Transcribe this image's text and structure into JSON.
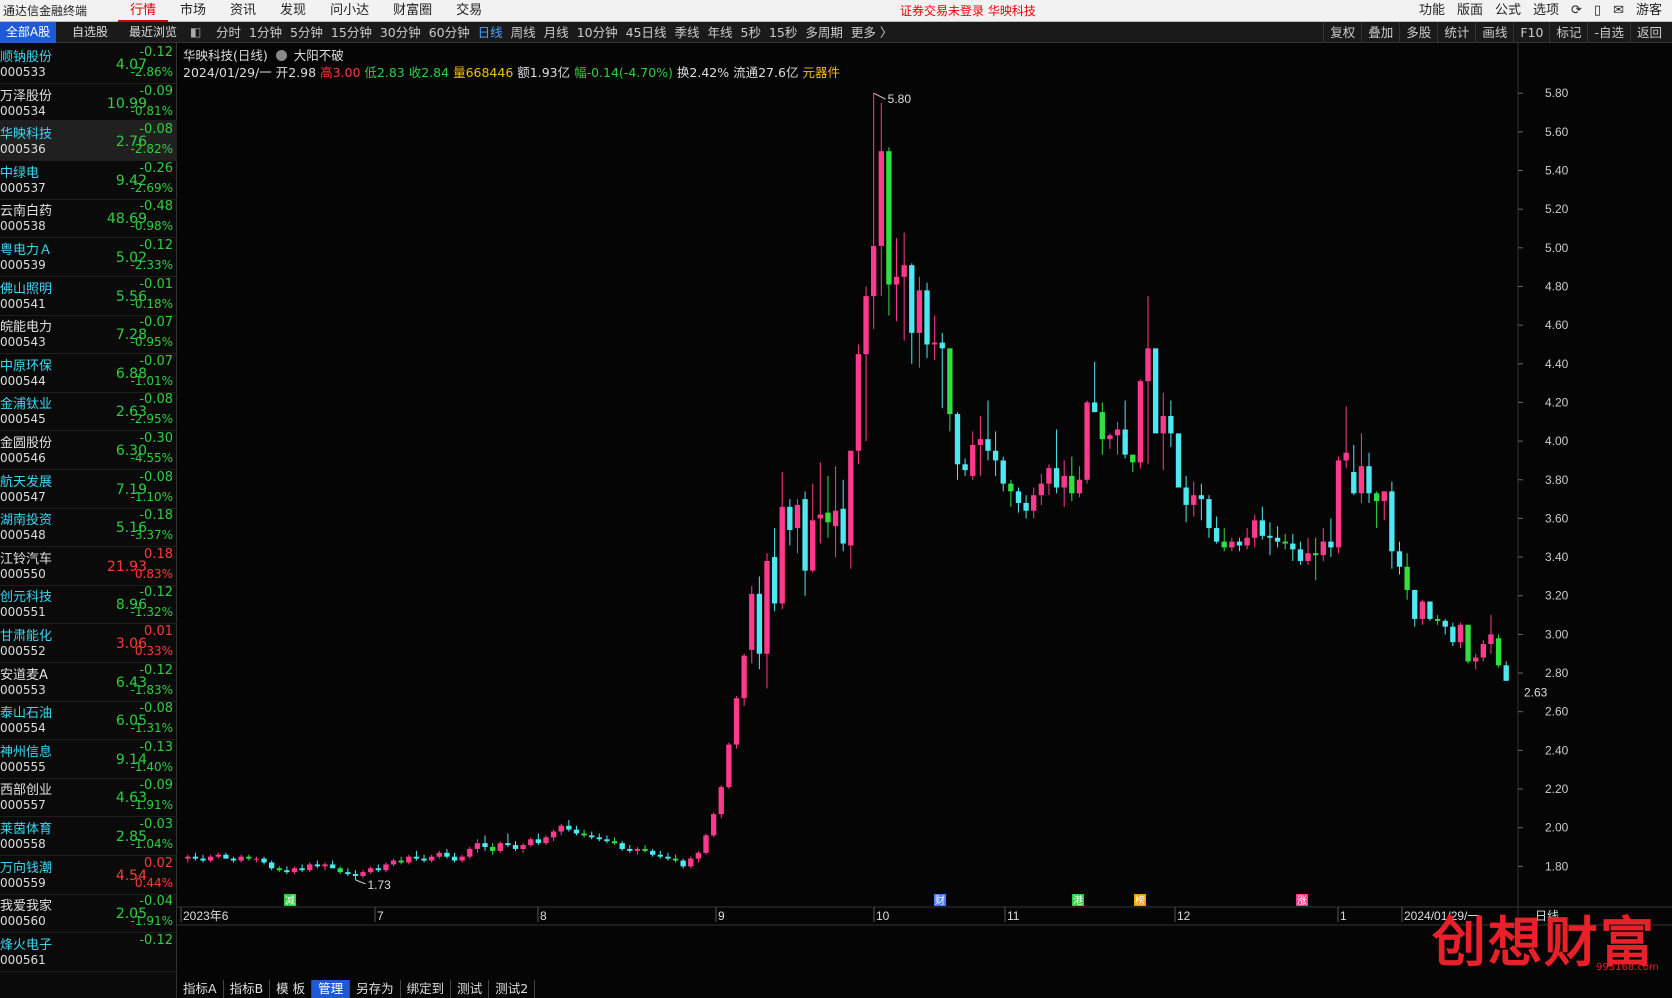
{
  "topbar": {
    "app_title": "通达信金融终端",
    "menu": [
      "行情",
      "市场",
      "资讯",
      "发现",
      "问小达",
      "财富圈",
      "交易"
    ],
    "active_menu": "行情",
    "notice": "证券交易未登录  华映科技",
    "right": [
      "功能",
      "版面",
      "公式",
      "选项",
      "⟳",
      "▯",
      "✉",
      "游客"
    ]
  },
  "periodbar": {
    "list_tabs": [
      "全部A股",
      "自选股",
      "最近浏览"
    ],
    "periods": [
      "分时",
      "1分钟",
      "5分钟",
      "15分钟",
      "30分钟",
      "60分钟",
      "日线",
      "周线",
      "月线",
      "10分钟",
      "45日线",
      "季线",
      "年线",
      "5秒",
      "15秒",
      "多周期",
      "更多 〉"
    ],
    "active_period": "日线",
    "tools": [
      "复权",
      "叠加",
      "多股",
      "统计",
      "画线",
      "F10",
      "标记",
      "-自选",
      "返回"
    ]
  },
  "stocks": [
    {
      "name": "顺钠股份",
      "code": "000533",
      "price": "4.07",
      "chg": "-0.12",
      "pct": "-2.86%"
    },
    {
      "name": "万泽股份",
      "code": "000534",
      "price": "10.99",
      "chg": "-0.09",
      "pct": "-0.81%"
    },
    {
      "name": "华映科技",
      "code": "000536",
      "price": "2.76",
      "chg": "-0.08",
      "pct": "-2.82%"
    },
    {
      "name": "中绿电",
      "code": "000537",
      "price": "9.42",
      "chg": "-0.26",
      "pct": "-2.69%"
    },
    {
      "name": "云南白药",
      "code": "000538",
      "price": "48.69",
      "chg": "-0.48",
      "pct": "-0.98%"
    },
    {
      "name": "粤电力Ａ",
      "code": "000539",
      "price": "5.02",
      "chg": "-0.12",
      "pct": "-2.33%"
    },
    {
      "name": "佛山照明",
      "code": "000541",
      "price": "5.56",
      "chg": "-0.01",
      "pct": "-0.18%"
    },
    {
      "name": "皖能电力",
      "code": "000543",
      "price": "7.28",
      "chg": "-0.07",
      "pct": "-0.95%"
    },
    {
      "name": "中原环保",
      "code": "000544",
      "price": "6.88",
      "chg": "-0.07",
      "pct": "-1.01%"
    },
    {
      "name": "金浦钛业",
      "code": "000545",
      "price": "2.63",
      "chg": "-0.08",
      "pct": "-2.95%"
    },
    {
      "name": "金圆股份",
      "code": "000546",
      "price": "6.30",
      "chg": "-0.30",
      "pct": "-4.55%"
    },
    {
      "name": "航天发展",
      "code": "000547",
      "price": "7.19",
      "chg": "-0.08",
      "pct": "-1.10%"
    },
    {
      "name": "湖南投资",
      "code": "000548",
      "price": "5.16",
      "chg": "-0.18",
      "pct": "-3.37%"
    },
    {
      "name": "江铃汽车",
      "code": "000550",
      "price": "21.93",
      "chg": "0.18",
      "pct": "0.83%"
    },
    {
      "name": "创元科技",
      "code": "000551",
      "price": "8.96",
      "chg": "-0.12",
      "pct": "-1.32%"
    },
    {
      "name": "甘肃能化",
      "code": "000552",
      "price": "3.06",
      "chg": "0.01",
      "pct": "0.33%"
    },
    {
      "name": "安道麦A",
      "code": "000553",
      "price": "6.43",
      "chg": "-0.12",
      "pct": "-1.83%"
    },
    {
      "name": "泰山石油",
      "code": "000554",
      "price": "6.05",
      "chg": "-0.08",
      "pct": "-1.31%"
    },
    {
      "name": "神州信息",
      "code": "000555",
      "price": "9.14",
      "chg": "-0.13",
      "pct": "-1.40%"
    },
    {
      "name": "西部创业",
      "code": "000557",
      "price": "4.63",
      "chg": "-0.09",
      "pct": "-1.91%"
    },
    {
      "name": "莱茵体育",
      "code": "000558",
      "price": "2.85",
      "chg": "-0.03",
      "pct": "-1.04%"
    },
    {
      "name": "万向钱潮",
      "code": "000559",
      "price": "4.54",
      "chg": "0.02",
      "pct": "0.44%"
    },
    {
      "name": "我爱我家",
      "code": "000560",
      "price": "2.05",
      "chg": "-0.04",
      "pct": "-1.91%"
    },
    {
      "name": "烽火电子",
      "code": "000561",
      "price": "",
      "chg": "-0.12",
      "pct": ""
    }
  ],
  "chart_header": {
    "title": "华映科技(日线)",
    "signal": "大阳不破",
    "date": "2024/01/29/一",
    "open": "开2.98",
    "high": "高3.00",
    "low": "低2.83",
    "close": "收2.84",
    "vol": "量668446",
    "amt": "额1.93亿",
    "range": "幅-0.14(-4.70%)",
    "turnover": "换2.42%",
    "float": "流通27.6亿",
    "sector": "元器件"
  },
  "bottomtabs": [
    "指标A",
    "指标B",
    "模 板",
    "管理",
    "另存为",
    "绑定到",
    "测试",
    "测试2"
  ],
  "watermark": {
    "text": "创想财富",
    "url": "995168.com"
  },
  "colors": {
    "up": "#ff3a8c",
    "down_cyan": "#4ee8f0",
    "down_green": "#30e040"
  },
  "chart_data": {
    "type": "candlestick",
    "title": "华映科技(日线)",
    "ylim": [
      1.6,
      5.92
    ],
    "yticks": [
      "5.80",
      "5.60",
      "5.40",
      "5.20",
      "5.00",
      "4.80",
      "4.60",
      "4.40",
      "4.20",
      "4.00",
      "3.80",
      "3.60",
      "3.40",
      "3.20",
      "3.00",
      "2.80",
      "2.60",
      "2.40",
      "2.20",
      "2.00",
      "1.80"
    ],
    "xlabels": [
      "2023年6",
      "7",
      "8",
      "9",
      "10",
      "11",
      "12",
      "1",
      "2024/01/29/一"
    ],
    "annotations": {
      "high": "5.80",
      "low": "1.73",
      "last_price": "2.63",
      "period_label": "日线"
    },
    "event_markers": [
      "减",
      "财",
      "港",
      "榜",
      "涨"
    ],
    "candles": [
      [
        1.84,
        1.86,
        1.82,
        1.85
      ],
      [
        1.85,
        1.87,
        1.83,
        1.84
      ],
      [
        1.84,
        1.86,
        1.82,
        1.83
      ],
      [
        1.83,
        1.86,
        1.82,
        1.85
      ],
      [
        1.85,
        1.87,
        1.84,
        1.86
      ],
      [
        1.86,
        1.87,
        1.84,
        1.84
      ],
      [
        1.84,
        1.85,
        1.82,
        1.83
      ],
      [
        1.83,
        1.86,
        1.82,
        1.85
      ],
      [
        1.85,
        1.86,
        1.83,
        1.84
      ],
      [
        1.84,
        1.85,
        1.82,
        1.84
      ],
      [
        1.84,
        1.85,
        1.81,
        1.82
      ],
      [
        1.82,
        1.83,
        1.78,
        1.79
      ],
      [
        1.79,
        1.8,
        1.77,
        1.78
      ],
      [
        1.78,
        1.8,
        1.76,
        1.77
      ],
      [
        1.77,
        1.8,
        1.76,
        1.79
      ],
      [
        1.79,
        1.81,
        1.77,
        1.78
      ],
      [
        1.78,
        1.82,
        1.77,
        1.81
      ],
      [
        1.81,
        1.83,
        1.79,
        1.8
      ],
      [
        1.8,
        1.82,
        1.78,
        1.81
      ],
      [
        1.81,
        1.83,
        1.79,
        1.79
      ],
      [
        1.79,
        1.8,
        1.76,
        1.77
      ],
      [
        1.77,
        1.79,
        1.75,
        1.76
      ],
      [
        1.76,
        1.78,
        1.73,
        1.75
      ],
      [
        1.75,
        1.78,
        1.74,
        1.77
      ],
      [
        1.77,
        1.8,
        1.76,
        1.79
      ],
      [
        1.79,
        1.81,
        1.77,
        1.78
      ],
      [
        1.78,
        1.82,
        1.77,
        1.81
      ],
      [
        1.81,
        1.84,
        1.8,
        1.83
      ],
      [
        1.83,
        1.85,
        1.81,
        1.82
      ],
      [
        1.82,
        1.86,
        1.81,
        1.85
      ],
      [
        1.85,
        1.88,
        1.83,
        1.84
      ],
      [
        1.84,
        1.86,
        1.82,
        1.83
      ],
      [
        1.83,
        1.86,
        1.82,
        1.85
      ],
      [
        1.85,
        1.88,
        1.84,
        1.87
      ],
      [
        1.87,
        1.89,
        1.84,
        1.85
      ],
      [
        1.85,
        1.87,
        1.82,
        1.83
      ],
      [
        1.83,
        1.86,
        1.82,
        1.85
      ],
      [
        1.85,
        1.9,
        1.84,
        1.89
      ],
      [
        1.89,
        1.94,
        1.87,
        1.92
      ],
      [
        1.92,
        1.96,
        1.88,
        1.9
      ],
      [
        1.9,
        1.92,
        1.86,
        1.88
      ],
      [
        1.88,
        1.93,
        1.87,
        1.92
      ],
      [
        1.92,
        1.97,
        1.9,
        1.91
      ],
      [
        1.91,
        1.93,
        1.88,
        1.89
      ],
      [
        1.89,
        1.92,
        1.87,
        1.91
      ],
      [
        1.91,
        1.95,
        1.9,
        1.94
      ],
      [
        1.94,
        1.97,
        1.91,
        1.92
      ],
      [
        1.92,
        1.96,
        1.91,
        1.95
      ],
      [
        1.95,
        1.99,
        1.93,
        1.98
      ],
      [
        1.98,
        2.02,
        1.96,
        2.01
      ],
      [
        2.01,
        2.04,
        1.98,
        1.99
      ],
      [
        1.99,
        2.01,
        1.96,
        1.97
      ],
      [
        1.97,
        1.99,
        1.95,
        1.96
      ],
      [
        1.96,
        1.98,
        1.94,
        1.95
      ],
      [
        1.95,
        1.97,
        1.93,
        1.94
      ],
      [
        1.94,
        1.96,
        1.92,
        1.93
      ],
      [
        1.93,
        1.95,
        1.91,
        1.92
      ],
      [
        1.92,
        1.93,
        1.88,
        1.89
      ],
      [
        1.89,
        1.91,
        1.87,
        1.88
      ],
      [
        1.88,
        1.9,
        1.86,
        1.89
      ],
      [
        1.89,
        1.91,
        1.87,
        1.88
      ],
      [
        1.88,
        1.89,
        1.85,
        1.86
      ],
      [
        1.86,
        1.88,
        1.84,
        1.85
      ],
      [
        1.85,
        1.87,
        1.83,
        1.84
      ],
      [
        1.84,
        1.86,
        1.82,
        1.83
      ],
      [
        1.83,
        1.84,
        1.79,
        1.8
      ],
      [
        1.8,
        1.85,
        1.79,
        1.84
      ],
      [
        1.84,
        1.88,
        1.82,
        1.87
      ],
      [
        1.87,
        1.97,
        1.86,
        1.96
      ],
      [
        1.96,
        2.08,
        1.95,
        2.07
      ],
      [
        2.07,
        2.22,
        2.05,
        2.21
      ],
      [
        2.21,
        2.44,
        2.2,
        2.43
      ],
      [
        2.43,
        2.68,
        2.41,
        2.67
      ],
      [
        2.67,
        2.9,
        2.63,
        2.89
      ],
      [
        2.92,
        3.25,
        2.85,
        3.21
      ],
      [
        3.21,
        3.3,
        2.82,
        2.9
      ],
      [
        2.9,
        3.42,
        2.72,
        3.38
      ],
      [
        3.4,
        3.55,
        3.12,
        3.16
      ],
      [
        3.16,
        3.84,
        3.13,
        3.66
      ],
      [
        3.66,
        3.7,
        3.46,
        3.54
      ],
      [
        3.55,
        3.7,
        3.42,
        3.67
      ],
      [
        3.7,
        3.74,
        3.2,
        3.33
      ],
      [
        3.33,
        3.78,
        3.32,
        3.59
      ],
      [
        3.6,
        3.89,
        3.47,
        3.62
      ],
      [
        3.63,
        3.82,
        3.5,
        3.58
      ],
      [
        3.56,
        3.87,
        3.4,
        3.64
      ],
      [
        3.65,
        3.8,
        3.43,
        3.47
      ],
      [
        3.46,
        3.95,
        3.34,
        3.95
      ],
      [
        3.95,
        4.5,
        3.88,
        4.45
      ],
      [
        4.45,
        4.8,
        4.0,
        4.75
      ],
      [
        4.75,
        5.8,
        4.58,
        5.01
      ],
      [
        5.01,
        5.75,
        4.75,
        5.5
      ],
      [
        5.5,
        5.52,
        4.65,
        4.81
      ],
      [
        4.81,
        5.05,
        4.62,
        4.85
      ],
      [
        4.85,
        5.08,
        4.52,
        4.91
      ],
      [
        4.91,
        4.92,
        4.4,
        4.56
      ],
      [
        4.56,
        4.85,
        4.38,
        4.78
      ],
      [
        4.78,
        4.82,
        4.43,
        4.5
      ],
      [
        4.5,
        4.65,
        4.42,
        4.51
      ],
      [
        4.51,
        4.56,
        4.17,
        4.48
      ],
      [
        4.48,
        4.44,
        4.05,
        4.14
      ],
      [
        4.14,
        4.15,
        3.8,
        3.88
      ],
      [
        3.88,
        3.91,
        3.82,
        3.85
      ],
      [
        3.82,
        4.05,
        3.8,
        3.98
      ],
      [
        3.98,
        4.13,
        3.82,
        4.01
      ],
      [
        4.01,
        4.21,
        3.9,
        3.95
      ],
      [
        3.95,
        4.05,
        3.82,
        3.9
      ],
      [
        3.9,
        3.92,
        3.74,
        3.78
      ],
      [
        3.78,
        3.8,
        3.66,
        3.74
      ],
      [
        3.74,
        3.76,
        3.63,
        3.68
      ],
      [
        3.68,
        3.72,
        3.6,
        3.64
      ],
      [
        3.64,
        3.76,
        3.6,
        3.72
      ],
      [
        3.72,
        3.83,
        3.67,
        3.78
      ],
      [
        3.78,
        3.88,
        3.72,
        3.86
      ],
      [
        3.86,
        4.06,
        3.73,
        3.76
      ],
      [
        3.76,
        3.9,
        3.66,
        3.82
      ],
      [
        3.82,
        3.92,
        3.69,
        3.73
      ],
      [
        3.73,
        3.87,
        3.71,
        3.8
      ],
      [
        3.8,
        4.21,
        3.78,
        4.2
      ],
      [
        4.2,
        4.41,
        4.15,
        4.15
      ],
      [
        4.15,
        4.2,
        3.93,
        4.01
      ],
      [
        4.01,
        4.04,
        3.96,
        4.03
      ],
      [
        4.03,
        4.1,
        3.93,
        4.06
      ],
      [
        4.06,
        4.21,
        3.91,
        3.93
      ],
      [
        3.93,
        3.89,
        3.84,
        3.89
      ],
      [
        3.89,
        4.32,
        3.86,
        4.31
      ],
      [
        4.31,
        4.75,
        3.88,
        4.48
      ],
      [
        4.48,
        4.29,
        4.04,
        4.04
      ],
      [
        4.04,
        4.25,
        3.85,
        4.13
      ],
      [
        4.13,
        4.21,
        3.97,
        4.04
      ],
      [
        4.04,
        4.0,
        3.76,
        3.76
      ],
      [
        3.76,
        3.82,
        3.58,
        3.67
      ],
      [
        3.67,
        3.79,
        3.61,
        3.72
      ],
      [
        3.72,
        3.78,
        3.59,
        3.7
      ],
      [
        3.7,
        3.72,
        3.5,
        3.55
      ],
      [
        3.55,
        3.61,
        3.47,
        3.48
      ],
      [
        3.48,
        3.55,
        3.43,
        3.45
      ],
      [
        3.45,
        3.5,
        3.43,
        3.48
      ],
      [
        3.48,
        3.5,
        3.43,
        3.46
      ],
      [
        3.46,
        3.55,
        3.44,
        3.5
      ],
      [
        3.5,
        3.62,
        3.45,
        3.59
      ],
      [
        3.59,
        3.66,
        3.49,
        3.51
      ],
      [
        3.51,
        3.58,
        3.41,
        3.5
      ],
      [
        3.5,
        3.56,
        3.45,
        3.48
      ],
      [
        3.48,
        3.52,
        3.44,
        3.47
      ],
      [
        3.47,
        3.52,
        3.38,
        3.44
      ],
      [
        3.44,
        3.48,
        3.36,
        3.38
      ],
      [
        3.38,
        3.5,
        3.36,
        3.42
      ],
      [
        3.42,
        3.5,
        3.28,
        3.41
      ],
      [
        3.41,
        3.55,
        3.38,
        3.48
      ],
      [
        3.48,
        3.6,
        3.4,
        3.45
      ],
      [
        3.45,
        3.92,
        3.42,
        3.9
      ],
      [
        3.9,
        4.18,
        3.86,
        3.94
      ],
      [
        3.84,
        3.98,
        3.72,
        3.73
      ],
      [
        3.73,
        4.04,
        3.68,
        3.87
      ],
      [
        3.87,
        3.94,
        3.68,
        3.73
      ],
      [
        3.73,
        3.74,
        3.55,
        3.69
      ],
      [
        3.69,
        3.74,
        3.59,
        3.74
      ],
      [
        3.74,
        3.79,
        3.34,
        3.43
      ],
      [
        3.43,
        3.48,
        3.31,
        3.35
      ],
      [
        3.35,
        3.42,
        3.18,
        3.23
      ],
      [
        3.23,
        3.23,
        3.04,
        3.08
      ],
      [
        3.08,
        3.18,
        3.05,
        3.17
      ],
      [
        3.17,
        3.17,
        3.07,
        3.08
      ],
      [
        3.08,
        3.1,
        3.05,
        3.07
      ],
      [
        3.07,
        3.08,
        3.0,
        3.04
      ],
      [
        3.04,
        3.06,
        2.94,
        2.96
      ],
      [
        2.96,
        3.06,
        2.93,
        3.05
      ],
      [
        3.05,
        3.04,
        2.85,
        2.86
      ],
      [
        2.86,
        2.9,
        2.82,
        2.88
      ],
      [
        2.88,
        2.97,
        2.86,
        2.95
      ],
      [
        2.95,
        3.1,
        2.9,
        3.0
      ],
      [
        2.98,
        3.0,
        2.83,
        2.84
      ],
      [
        2.84,
        2.86,
        2.76,
        2.76
      ]
    ]
  }
}
